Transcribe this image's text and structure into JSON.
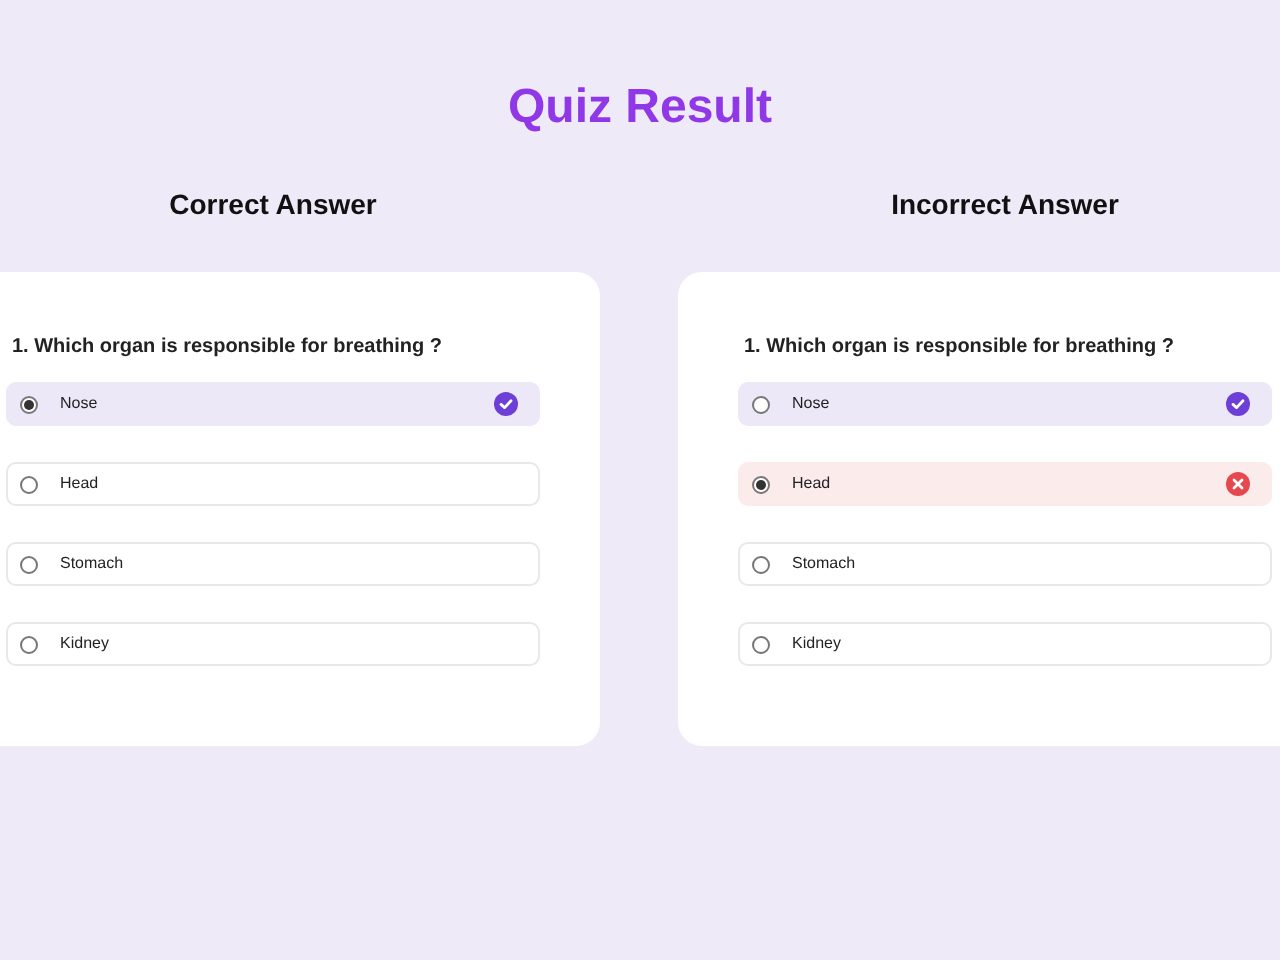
{
  "title": "Quiz Result",
  "panels": [
    {
      "heading": "Correct Answer",
      "question": "1. Which organ is responsible for breathing ?",
      "options": [
        {
          "label": "Nose",
          "selected": true,
          "kind": "correct"
        },
        {
          "label": "Head",
          "selected": false,
          "kind": "plain"
        },
        {
          "label": "Stomach",
          "selected": false,
          "kind": "plain"
        },
        {
          "label": "Kidney",
          "selected": false,
          "kind": "plain"
        }
      ]
    },
    {
      "heading": "Incorrect Answer",
      "question": "1. Which organ is responsible for breathing ?",
      "options": [
        {
          "label": "Nose",
          "selected": false,
          "kind": "correct"
        },
        {
          "label": "Head",
          "selected": true,
          "kind": "wrong"
        },
        {
          "label": "Stomach",
          "selected": false,
          "kind": "plain"
        },
        {
          "label": "Kidney",
          "selected": false,
          "kind": "plain"
        }
      ]
    }
  ]
}
